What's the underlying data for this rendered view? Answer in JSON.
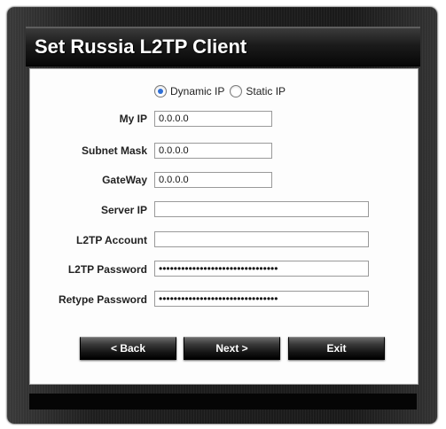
{
  "dialog": {
    "title": "Set Russia L2TP Client"
  },
  "ip_mode": {
    "dynamic_label": "Dynamic IP",
    "static_label": "Static IP",
    "selected": "Dynamic IP"
  },
  "fields": {
    "my_ip": {
      "label": "My IP",
      "value": "0.0.0.0"
    },
    "subnet_mask": {
      "label": "Subnet Mask",
      "value": "0.0.0.0"
    },
    "gateway": {
      "label": "GateWay",
      "value": "0.0.0.0"
    },
    "server_ip": {
      "label": "Server IP",
      "value": ""
    },
    "l2tp_account": {
      "label": "L2TP Account",
      "value": ""
    },
    "l2tp_password": {
      "label": "L2TP Password",
      "value": "••••••••••••••••••••••••••••••••"
    },
    "retype_password": {
      "label": "Retype Password",
      "value": "••••••••••••••••••••••••••••••••"
    }
  },
  "buttons": {
    "back": "< Back",
    "next": "Next >",
    "exit": "Exit"
  }
}
